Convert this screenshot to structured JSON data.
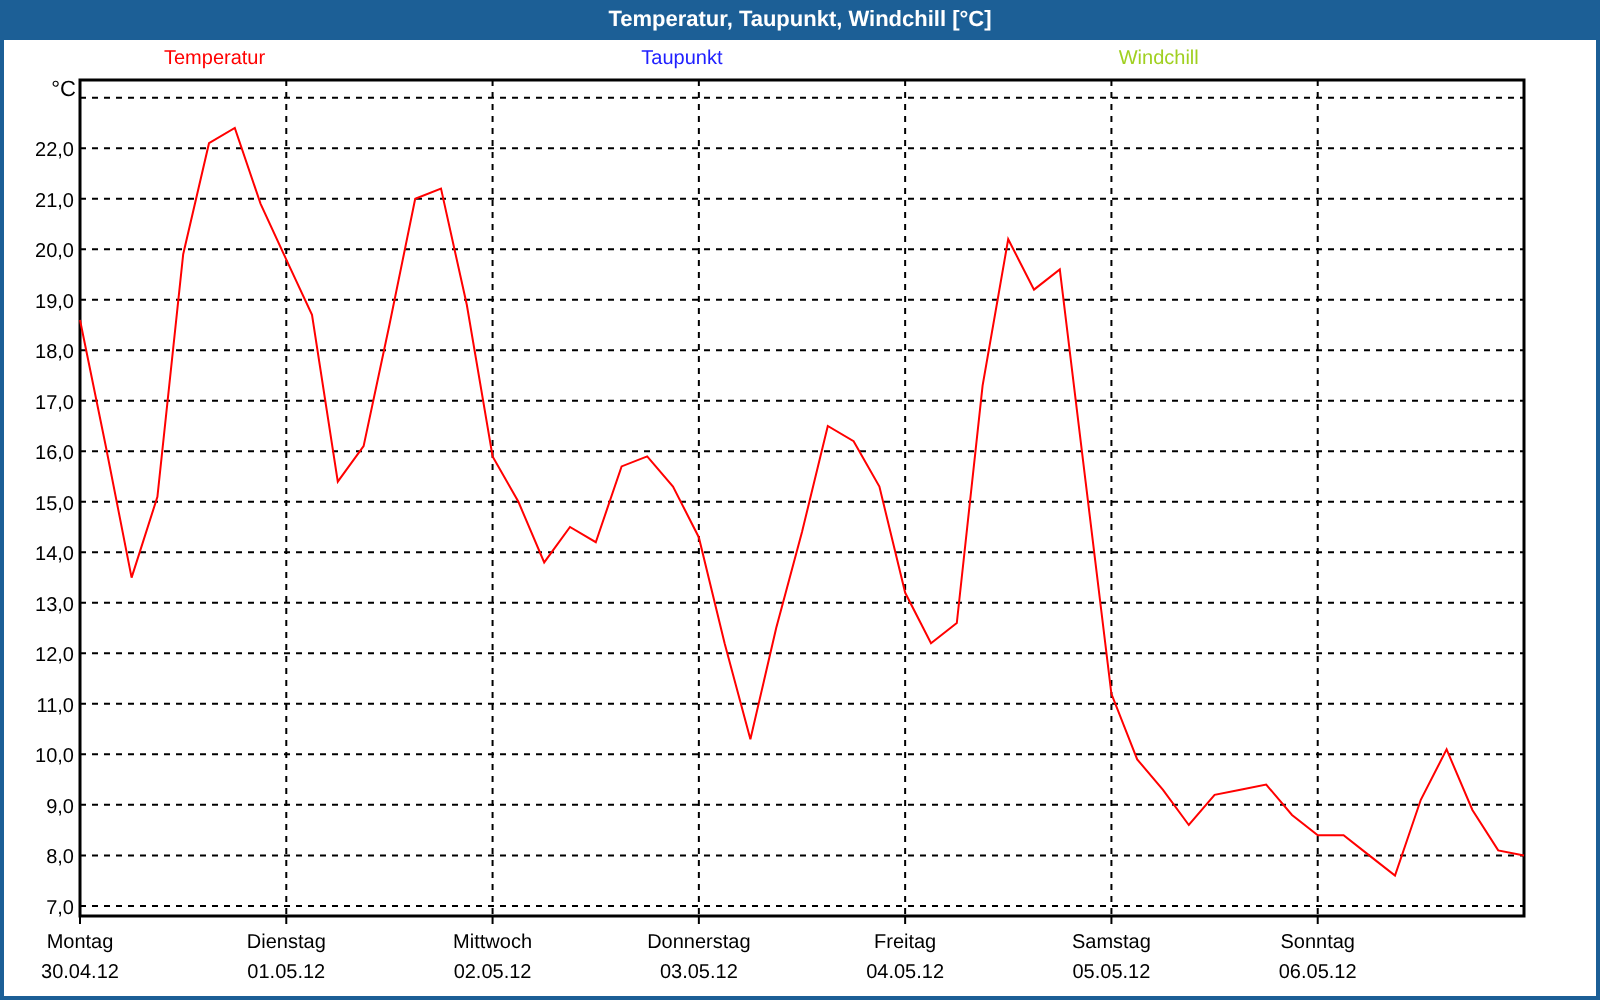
{
  "window": {
    "title": "Temperatur, Taupunkt, Windchill [°C]"
  },
  "legend": [
    {
      "label": "Taupunkt",
      "color": "#2020ff"
    },
    {
      "label": "Windchill",
      "color": "#a0d020"
    }
  ],
  "x_axis_dates": [
    "30.04.12",
    "01.05.12",
    "02.05.12",
    "03.05.12",
    "04.05.12",
    "05.05.12",
    "06.05.12"
  ],
  "chart_data": {
    "type": "line",
    "grid": true,
    "ylabel": "°C",
    "ylim": [
      6.8,
      23.35
    ],
    "yticks": [
      {
        "value": 7,
        "label": "7,0"
      },
      {
        "value": 8,
        "label": "8,0"
      },
      {
        "value": 9,
        "label": "9,0"
      },
      {
        "value": 10,
        "label": "10,0"
      },
      {
        "value": 11,
        "label": "11,0"
      },
      {
        "value": 12,
        "label": "12,0"
      },
      {
        "value": 13,
        "label": "13,0"
      },
      {
        "value": 14,
        "label": "14,0"
      },
      {
        "value": 15,
        "label": "15,0"
      },
      {
        "value": 16,
        "label": "16,0"
      },
      {
        "value": 17,
        "label": "17,0"
      },
      {
        "value": 18,
        "label": "18,0"
      },
      {
        "value": 19,
        "label": "19,0"
      },
      {
        "value": 20,
        "label": "20,0"
      },
      {
        "value": 21,
        "label": "21,0"
      },
      {
        "value": 22,
        "label": "22,0"
      }
    ],
    "categories": [
      "Montag",
      null,
      null,
      null,
      null,
      null,
      null,
      null,
      "Dienstag",
      null,
      null,
      null,
      null,
      null,
      null,
      null,
      "Mittwoch",
      null,
      null,
      null,
      null,
      null,
      null,
      null,
      "Donnerstag",
      null,
      null,
      null,
      null,
      null,
      null,
      null,
      "Freitag",
      null,
      null,
      null,
      null,
      null,
      null,
      null,
      "Samstag",
      null,
      null,
      null,
      null,
      null,
      null,
      null,
      "Sonntag",
      null,
      null,
      null,
      null,
      null,
      null,
      null,
      null
    ],
    "series": [
      {
        "name": "Temperatur",
        "color": "#ff0000",
        "values": [
          18.6,
          16.1,
          13.5,
          15.1,
          19.9,
          22.1,
          22.4,
          20.9,
          19.8,
          18.7,
          15.4,
          16.1,
          18.5,
          21.0,
          21.2,
          18.9,
          15.9,
          15.0,
          13.8,
          14.5,
          14.2,
          15.7,
          15.9,
          15.3,
          14.3,
          12.2,
          10.3,
          12.5,
          14.4,
          16.5,
          16.2,
          15.3,
          13.2,
          12.2,
          12.6,
          17.3,
          20.2,
          19.2,
          19.6,
          15.4,
          11.2,
          9.9,
          9.3,
          8.6,
          9.2,
          9.3,
          9.4,
          8.8,
          8.4,
          8.4,
          8.0,
          7.6,
          9.1,
          10.1,
          8.9,
          8.1,
          8.0
        ]
      }
    ]
  }
}
